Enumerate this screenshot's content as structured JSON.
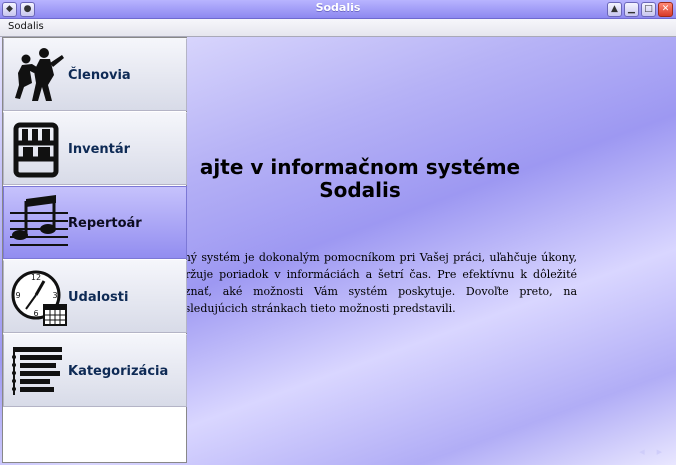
{
  "window": {
    "title": "Sodalis"
  },
  "menubar": {
    "items": [
      "Sodalis"
    ]
  },
  "sidebar": {
    "items": [
      {
        "label": "Členovia",
        "icon": "dancers-icon"
      },
      {
        "label": "Inventár",
        "icon": "shelf-icon"
      },
      {
        "label": "Repertoár",
        "icon": "music-notes-icon",
        "selected": true
      },
      {
        "label": "Udalosti",
        "icon": "clock-calendar-icon"
      },
      {
        "label": "Kategorizácia",
        "icon": "list-hierarchy-icon"
      }
    ]
  },
  "main": {
    "heading_line1": "ajte v informačnom systéme",
    "heading_line2": "Sodalis",
    "paragraph": "ačný systém je dokonalým pomocníkom pri Vašej práci, uľahčuje úkony, udržuje poriadok v informáciách a šetrí čas. Pre efektívnu k dôležité poznať, aké možnosti Vám systém poskytuje. Dovoľte preto, na nasledujúcich stránkach tieto možnosti predstavili."
  },
  "colors": {
    "titlebar": "#9a95f2",
    "content_background": "#b6b2f6",
    "selected_menu": "#928df0",
    "menu_label": "#0e2a55"
  }
}
